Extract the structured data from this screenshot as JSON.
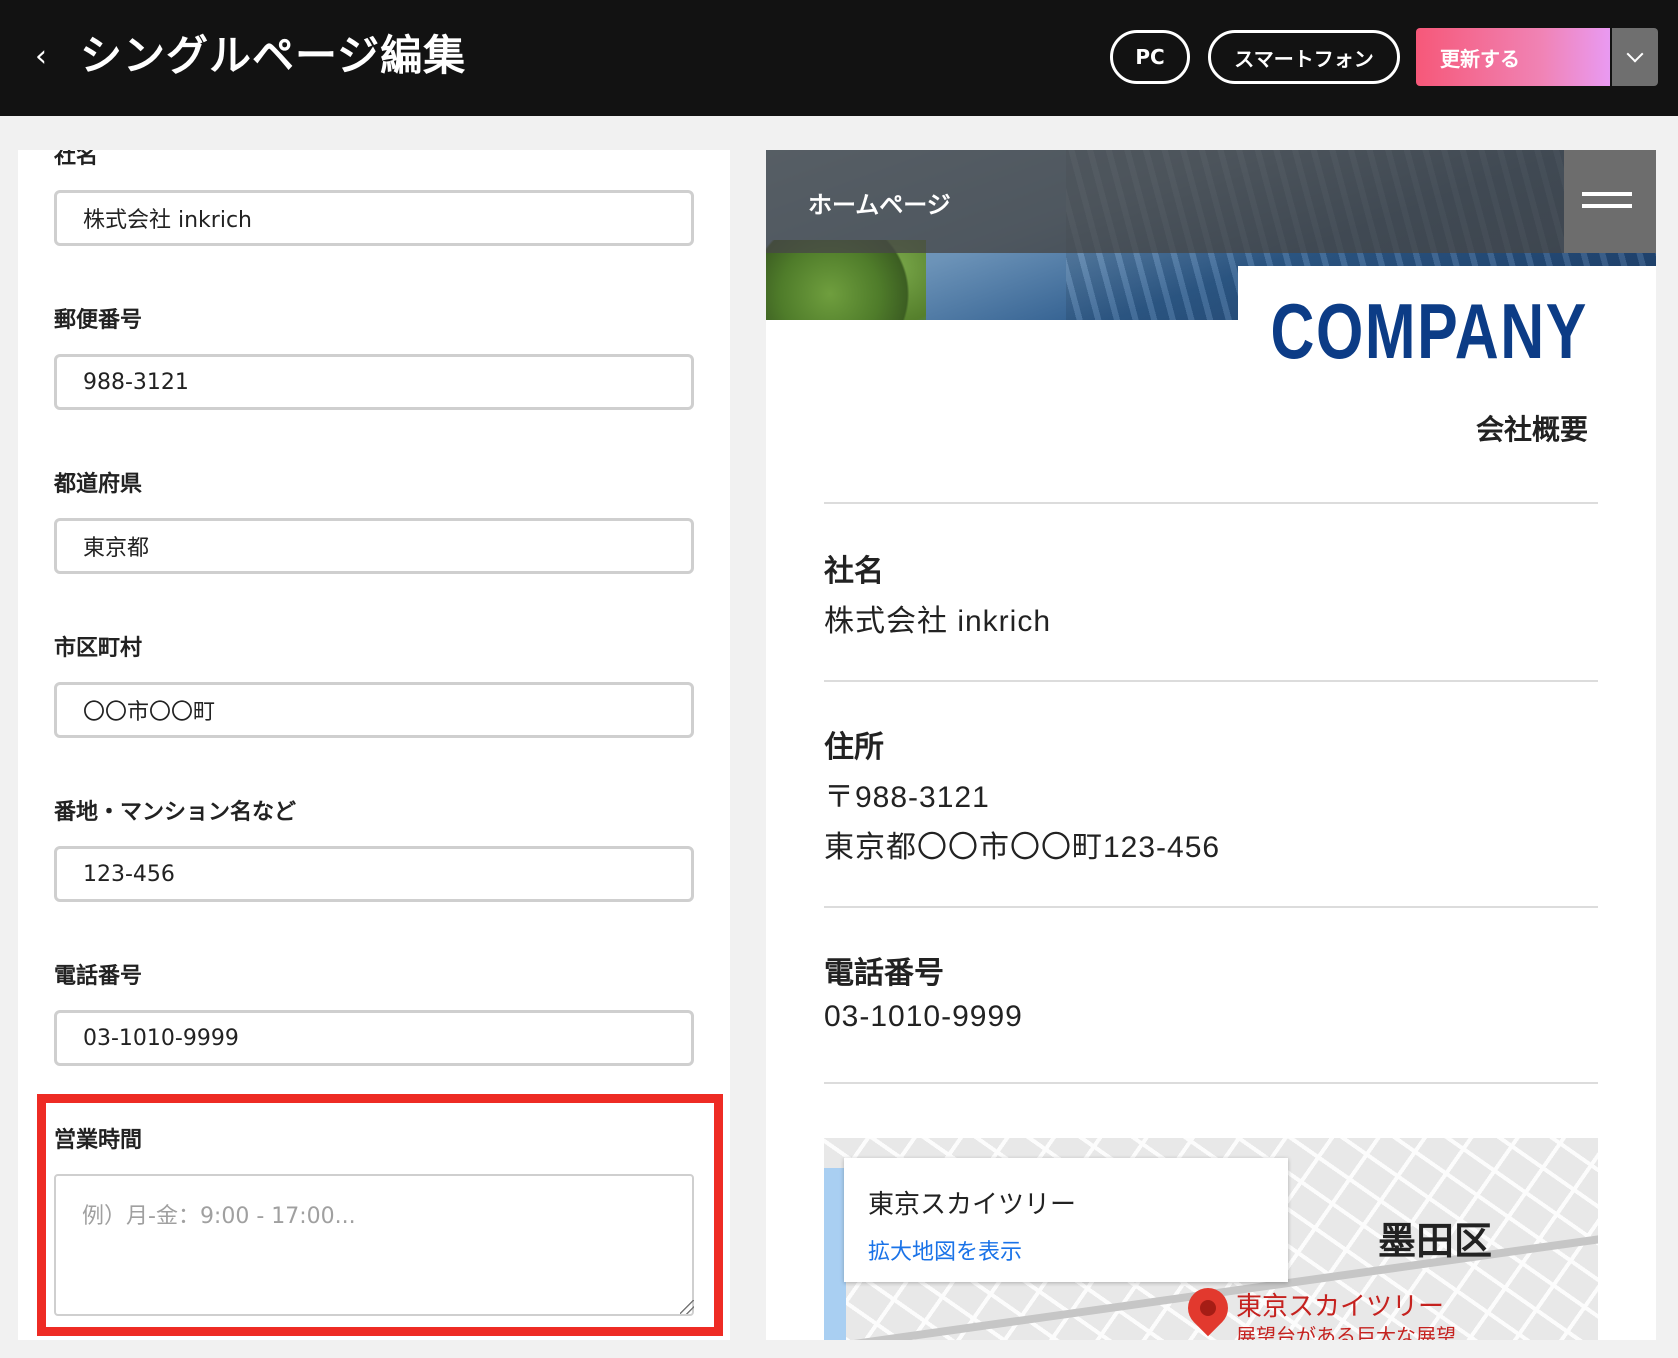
{
  "header": {
    "back_glyph": "‹",
    "title": "シングルページ編集",
    "view_pc": "PC",
    "view_smartphone": "スマートフォン",
    "update_label": "更新する",
    "update_dropdown_icon": "chevron-down-icon"
  },
  "form": {
    "fields": [
      {
        "label": "社名",
        "value": "株式会社 inkrich"
      },
      {
        "label": "郵便番号",
        "value": "988-3121"
      },
      {
        "label": "都道府県",
        "value": "東京都"
      },
      {
        "label": "市区町村",
        "value": "〇〇市〇〇町"
      },
      {
        "label": "番地・マンション名など",
        "value": "123-456"
      },
      {
        "label": "電話番号",
        "value": "03-1010-9999"
      }
    ],
    "hours": {
      "label": "営業時間",
      "value": "",
      "placeholder": "例）月-金：9:00 - 17:00..."
    },
    "highlight_color": "#ee2b24"
  },
  "preview": {
    "site_title": "ホームページ",
    "menu_icon": "hamburger-menu-icon",
    "heading": "COMPANY",
    "subheading": "会社概要",
    "heading_color": "#0c3c86",
    "sections": [
      {
        "label": "社名",
        "lines": [
          "株式会社 inkrich"
        ]
      },
      {
        "label": "住所",
        "lines": [
          "〒988-3121",
          "東京都〇〇市〇〇町123-456"
        ]
      },
      {
        "label": "電話番号",
        "lines": [
          "03-1010-9999"
        ]
      }
    ],
    "map": {
      "place_name": "東京スカイツリー",
      "enlarge_link": "拡大地図を表示",
      "district": "墨田区",
      "poi_name": "東京スカイツリー",
      "poi_description": "展望台がある巨大な展望"
    }
  }
}
